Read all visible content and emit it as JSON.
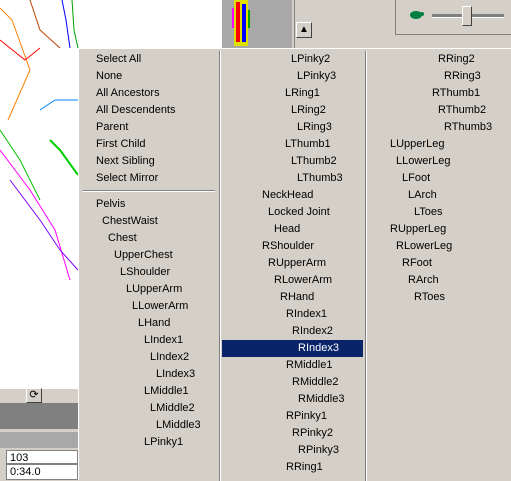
{
  "speed_panel": {
    "icon": "turtle-icon",
    "slider_value": 0.35
  },
  "time": {
    "frame": "103",
    "timecode": "0:34.0"
  },
  "menu": {
    "commands": [
      "Select All",
      "None",
      "All Ancestors",
      "All Descendents",
      "Parent",
      "First Child",
      "Next Sibling",
      "Select Mirror"
    ],
    "col1_joints": [
      "Pelvis",
      "ChestWaist",
      "Chest",
      "UpperChest",
      "LShoulder",
      "LUpperArm",
      "LLowerArm",
      "LHand",
      "LIndex1",
      "LIndex2",
      "LIndex3",
      "LMiddle1",
      "LMiddle2",
      "LMiddle3",
      "LPinky1"
    ],
    "col2_joints": [
      "LPinky2",
      "LPinky3",
      "LRing1",
      "LRing2",
      "LRing3",
      "LThumb1",
      "LThumb2",
      "LThumb3",
      "NeckHead",
      "Locked Joint",
      "Head",
      "RShoulder",
      "RUpperArm",
      "RLowerArm",
      "RHand",
      "RIndex1",
      "RIndex2",
      "RIndex3",
      "RMiddle1",
      "RMiddle2",
      "RMiddle3",
      "RPinky1",
      "RPinky2",
      "RPinky3",
      "RRing1"
    ],
    "col3_joints": [
      "RRing2",
      "RRing3",
      "RThumb1",
      "RThumb2",
      "RThumb3",
      "LUpperLeg",
      "LLowerLeg",
      "LFoot",
      "LArch",
      "LToes",
      "RUpperLeg",
      "RLowerLeg",
      "RFoot",
      "RArch",
      "RToes"
    ],
    "selected_item": "RIndex3"
  },
  "colors": {
    "menu_bg": "#d4d0c8",
    "highlight": "#0a246a"
  }
}
